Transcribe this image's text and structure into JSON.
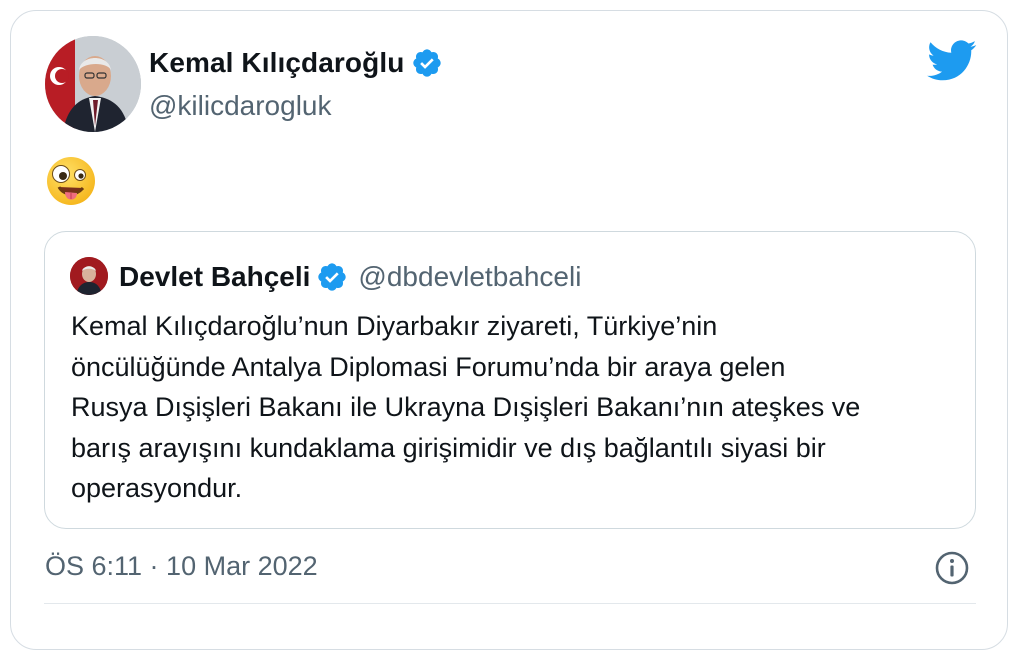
{
  "tweet": {
    "author_name": "Kemal Kılıçdaroğlu",
    "author_handle": "@kilicdarogluk",
    "body_emoji": "zany-face-emoji",
    "timestamp": "ÖS 6:11 · 10 Mar 2022"
  },
  "quoted_tweet": {
    "author_name": "Devlet Bahçeli",
    "author_handle": "@dbdevletbahceli",
    "text": "Kemal Kılıçdaroğlu’nun Diyarbakır ziyareti, Türkiye’nin\nöncülüğünde Antalya Diplomasi Forumu’nda bir araya gelen\nRusya Dışişleri Bakanı ile Ukrayna Dışişleri Bakanı’nın ateşkes ve\nbarış arayışını kundaklama girişimidir ve dış bağlantılı siyasi bir\noperasyondur."
  },
  "icons": {
    "verified": "verified-badge-icon",
    "brand": "twitter-bird-icon",
    "info": "info-icon"
  },
  "colors": {
    "brand_blue": "#1d9bf0",
    "text_primary": "#0f1419",
    "text_secondary": "#536471",
    "border": "#cfd9de"
  }
}
